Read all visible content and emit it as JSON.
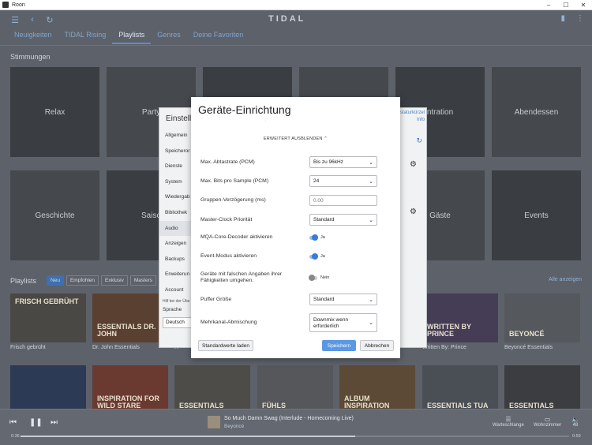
{
  "window": {
    "title": "Roon",
    "controls": [
      "–",
      "☐",
      "✕"
    ]
  },
  "nav": {
    "back": "‹",
    "refresh": "↻",
    "brand": "TIDAL",
    "bookmark": "▮",
    "menu": "⋮"
  },
  "tabs": [
    "Neuigkeiten",
    "TIDAL Rising",
    "Playlists",
    "Genres",
    "Deine Favoriten"
  ],
  "moods": {
    "title": "Stimmungen",
    "tiles": [
      "Relax",
      "Party",
      "",
      "",
      "ntration",
      "Abendessen",
      "Geschichte",
      "Saiso",
      "",
      "",
      "Gäste",
      "Events"
    ]
  },
  "playlists": {
    "title": "Playlists",
    "chips": [
      "Neu",
      "Empfohlen",
      "Exklusiv",
      "Masters"
    ],
    "all_link": "Alle anzeigen",
    "row1": [
      {
        "cover_text": "FRISCH GEBRÜHT",
        "label": "Frisch gebrüht"
      },
      {
        "cover_text": "ESSENTIALS DR. JOHN",
        "label": "Dr. John Essentials"
      },
      {
        "cover_text": "",
        "label": "R"
      },
      {
        "cover_text": "",
        "label": ""
      },
      {
        "cover_text": "",
        "label": ""
      },
      {
        "cover_text": "WRITTEN BY Prince",
        "label": "Written By: Prince"
      },
      {
        "cover_text": "BEYONCÉ",
        "label": "Beyoncé Essentials"
      }
    ],
    "row2": [
      {
        "cover_text": ""
      },
      {
        "cover_text": "INSPIRATION FOR WILD STARE"
      },
      {
        "cover_text": "ESSENTIALS"
      },
      {
        "cover_text": "FÜHLS"
      },
      {
        "cover_text": "ALBUM INSPIRATION"
      },
      {
        "cover_text": "ESSENTIALS TUA"
      },
      {
        "cover_text": "ESSENTIALS"
      }
    ]
  },
  "player": {
    "prev": "⏮",
    "pause": "❚❚",
    "next": "⏭",
    "track_title": "So Much Damn Swag (Interlude - Homecoming Live)",
    "artist": "Beyoncé",
    "queue_label": "Warteschlange",
    "zone_label": "Wohnzimmer",
    "volume": "48",
    "elapsed": "0:36",
    "remaining": "0:59",
    "progress_fraction": 0.61
  },
  "settings_panel": {
    "title": "Einstellu",
    "links": [
      "staturkürzel",
      "Info"
    ],
    "sidebar": [
      "Allgemein",
      "Speicheror",
      "Dienste",
      "System",
      "Wiedergab",
      "Bibliothek",
      "Audio",
      "Anzeigen",
      "Backups",
      "Erweiterun",
      "Account"
    ],
    "active": "Audio",
    "help_text": "Hilf bei der Übe",
    "language_label": "Sprache",
    "language_value": "Deutsch"
  },
  "dialog": {
    "title": "Geräte-Einrichtung",
    "dot": ".",
    "advanced_toggle": "ERWEITERT AUSBLENDEN",
    "rows": {
      "max_rate": {
        "label": "Max. Abtastrate (PCM)",
        "value": "Bis zu 96kHz"
      },
      "max_bits": {
        "label": "Max. Bits pro Sample (PCM)",
        "value": "24"
      },
      "group_delay": {
        "label": "Gruppen-Verzögerung (ms)",
        "placeholder": "0.00"
      },
      "master_clock": {
        "label": "Master-Clock Priorität",
        "value": "Standard"
      },
      "mqa": {
        "label": "MQA-Core-Decoder aktivieren",
        "value": "Ja"
      },
      "event_mode": {
        "label": "Event-Modus aktivieren",
        "value": "Ja"
      },
      "false_caps": {
        "label": "Geräte mit falschen Angaben ihrer Fähigkeiten umgehen.",
        "value": "Nein"
      },
      "buffer": {
        "label": "Puffer Größe",
        "value": "Standard"
      },
      "downmix": {
        "label": "Mehrkanal-Abmischung",
        "value": "Downmix wenn erforderlich"
      }
    },
    "btn_defaults": "Standardwerte laden",
    "btn_save": "Speichern",
    "btn_cancel": "Abbrechen"
  }
}
